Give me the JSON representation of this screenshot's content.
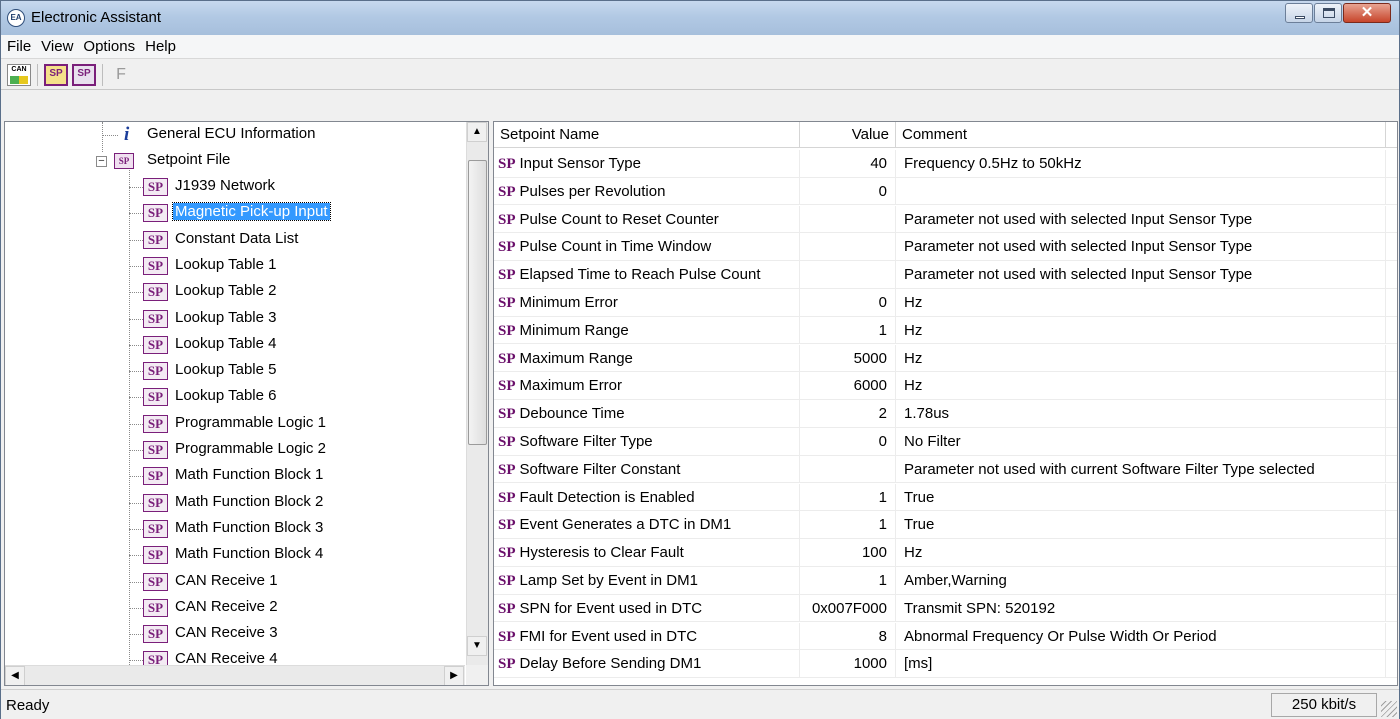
{
  "window": {
    "title": "Electronic Assistant",
    "app_icon_text": "EA"
  },
  "menu": [
    {
      "label": "File"
    },
    {
      "label": "View"
    },
    {
      "label": "Options"
    },
    {
      "label": "Help"
    }
  ],
  "toolbar": {
    "can_icon_text": "CAN",
    "sp_open_text": "SP",
    "sp_save_text": "SP",
    "f_label": "F"
  },
  "tree": {
    "general_label": "General ECU Information",
    "setpoint_folder_label": "Setpoint File",
    "expander_symbol": "−",
    "sp_icon_text": "SP",
    "info_icon_text": "i",
    "selected_index": 1,
    "items": [
      "J1939 Network",
      "Magnetic Pick-up Input",
      "Constant Data List",
      "Lookup Table 1",
      "Lookup Table 2",
      "Lookup Table 3",
      "Lookup Table 4",
      "Lookup Table 5",
      "Lookup Table 6",
      "Programmable Logic 1",
      "Programmable Logic 2",
      "Math Function Block 1",
      "Math Function Block 2",
      "Math Function Block 3",
      "Math Function Block 4",
      "CAN Receive 1",
      "CAN Receive 2",
      "CAN Receive 3",
      "CAN Receive 4"
    ]
  },
  "grid": {
    "headers": {
      "name": "Setpoint Name",
      "value": "Value",
      "comment": "Comment"
    },
    "sp_tag": "SP",
    "rows": [
      {
        "name": "Input Sensor Type",
        "value": "40",
        "comment": "Frequency 0.5Hz to 50kHz"
      },
      {
        "name": "Pulses per Revolution",
        "value": "0",
        "comment": ""
      },
      {
        "name": "Pulse Count to Reset Counter",
        "value": "",
        "comment": "Parameter not used with selected Input Sensor Type"
      },
      {
        "name": "Pulse Count in Time Window",
        "value": "",
        "comment": "Parameter not used with selected Input Sensor Type"
      },
      {
        "name": "Elapsed Time to Reach Pulse Count",
        "value": "",
        "comment": "Parameter not used with selected Input Sensor Type"
      },
      {
        "name": "Minimum Error",
        "value": "0",
        "comment": "Hz"
      },
      {
        "name": "Minimum Range",
        "value": "1",
        "comment": "Hz"
      },
      {
        "name": "Maximum Range",
        "value": "5000",
        "comment": "Hz"
      },
      {
        "name": "Maximum Error",
        "value": "6000",
        "comment": "Hz"
      },
      {
        "name": "Debounce Time",
        "value": "2",
        "comment": "1.78us"
      },
      {
        "name": "Software Filter Type",
        "value": "0",
        "comment": "No Filter"
      },
      {
        "name": "Software Filter Constant",
        "value": "",
        "comment": "Parameter not used with current Software Filter Type selected"
      },
      {
        "name": "Fault Detection is Enabled",
        "value": "1",
        "comment": "True"
      },
      {
        "name": "Event Generates a DTC in DM1",
        "value": "1",
        "comment": "True"
      },
      {
        "name": "Hysteresis to Clear Fault",
        "value": "100",
        "comment": "Hz"
      },
      {
        "name": "Lamp Set by Event in DM1",
        "value": "1",
        "comment": "Amber,Warning"
      },
      {
        "name": "SPN for Event used in DTC",
        "value": "0x007F000",
        "comment": "Transmit SPN: 520192"
      },
      {
        "name": "FMI for Event used in DTC",
        "value": "8",
        "comment": "Abnormal Frequency Or Pulse Width Or Period"
      },
      {
        "name": "Delay Before Sending DM1",
        "value": "1000",
        "comment": "[ms]"
      }
    ]
  },
  "status": {
    "text": "Ready",
    "baud_rate": "250 kbit/s"
  },
  "colors": {
    "selection": "#3399ff",
    "sp_purple": "#6a0f6a",
    "info_blue": "#1b3d9a"
  }
}
